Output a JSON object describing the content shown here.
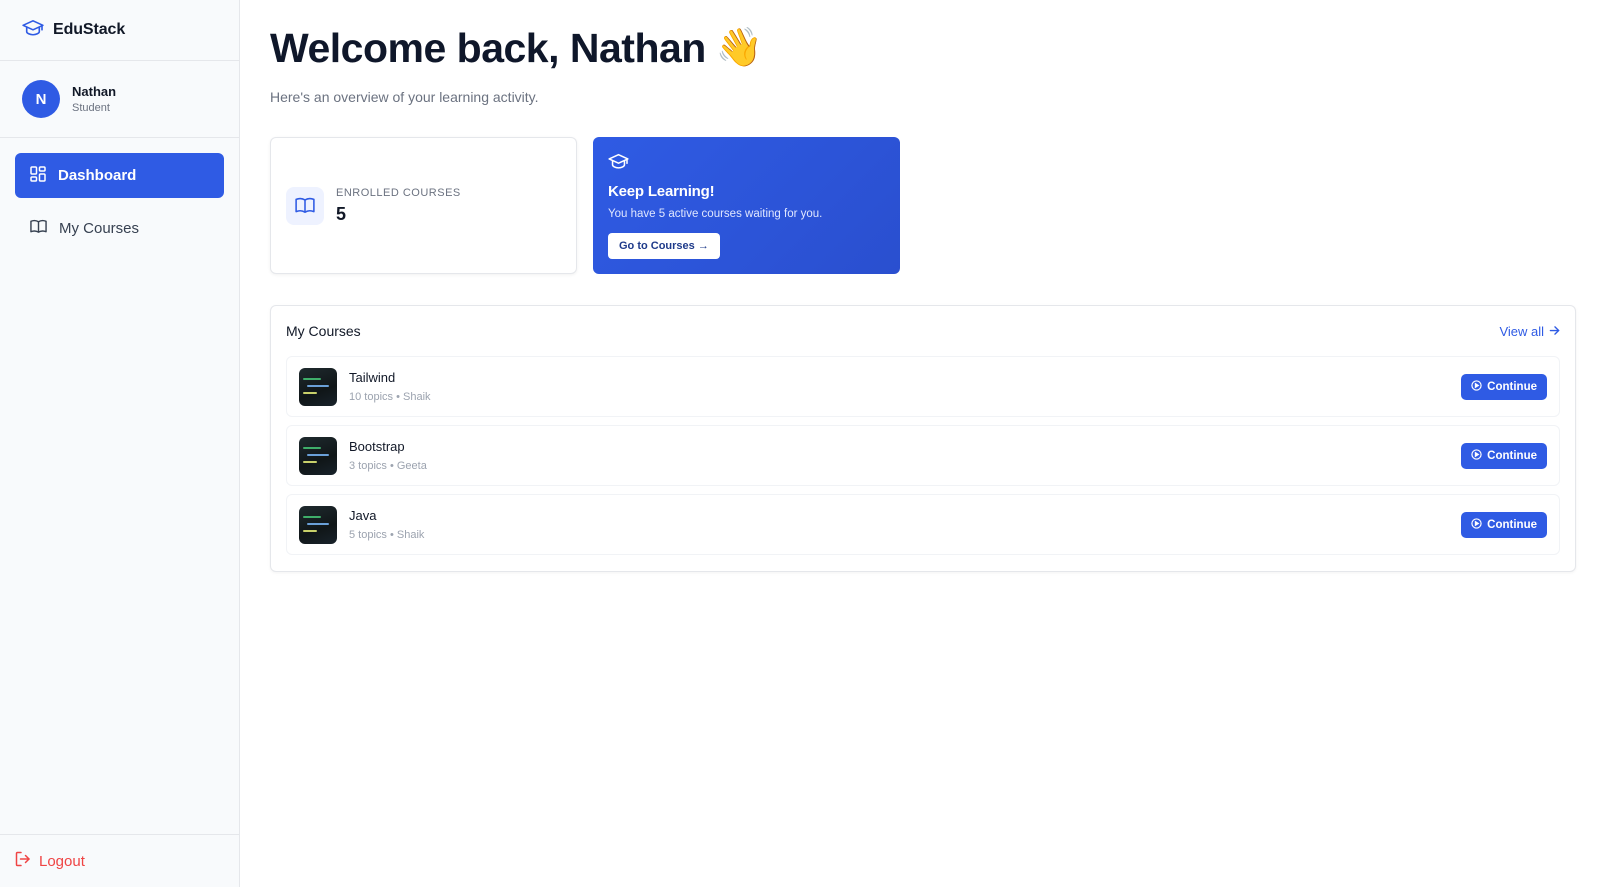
{
  "brand": {
    "name": "EduStack",
    "icon": "graduation-cap-icon"
  },
  "user": {
    "initial": "N",
    "name": "Nathan",
    "role": "Student"
  },
  "nav": {
    "items": [
      {
        "label": "Dashboard",
        "icon": "dashboard-grid-icon",
        "active": true
      },
      {
        "label": "My Courses",
        "icon": "book-open-icon",
        "active": false
      }
    ]
  },
  "logout": {
    "label": "Logout",
    "icon": "logout-icon"
  },
  "header": {
    "welcome": "Welcome back, Nathan",
    "emoji": "👋",
    "subtitle": "Here's an overview of your learning activity."
  },
  "stats": {
    "enrolled_label": "ENROLLED COURSES",
    "enrolled_value": "5"
  },
  "promo": {
    "title": "Keep Learning!",
    "text": "You have 5 active courses waiting for you.",
    "button_label": "Go to Courses →"
  },
  "courses_panel": {
    "title": "My Courses",
    "view_all_label": "View all",
    "continue_label": "Continue",
    "items": [
      {
        "name": "Tailwind",
        "meta": "10 topics • Shaik"
      },
      {
        "name": "Bootstrap",
        "meta": "3 topics • Geeta"
      },
      {
        "name": "Java",
        "meta": "5 topics • Shaik"
      }
    ]
  },
  "colors": {
    "accent": "#2f5be4",
    "danger": "#ef4444",
    "sidebar_bg": "#f8fafc"
  }
}
